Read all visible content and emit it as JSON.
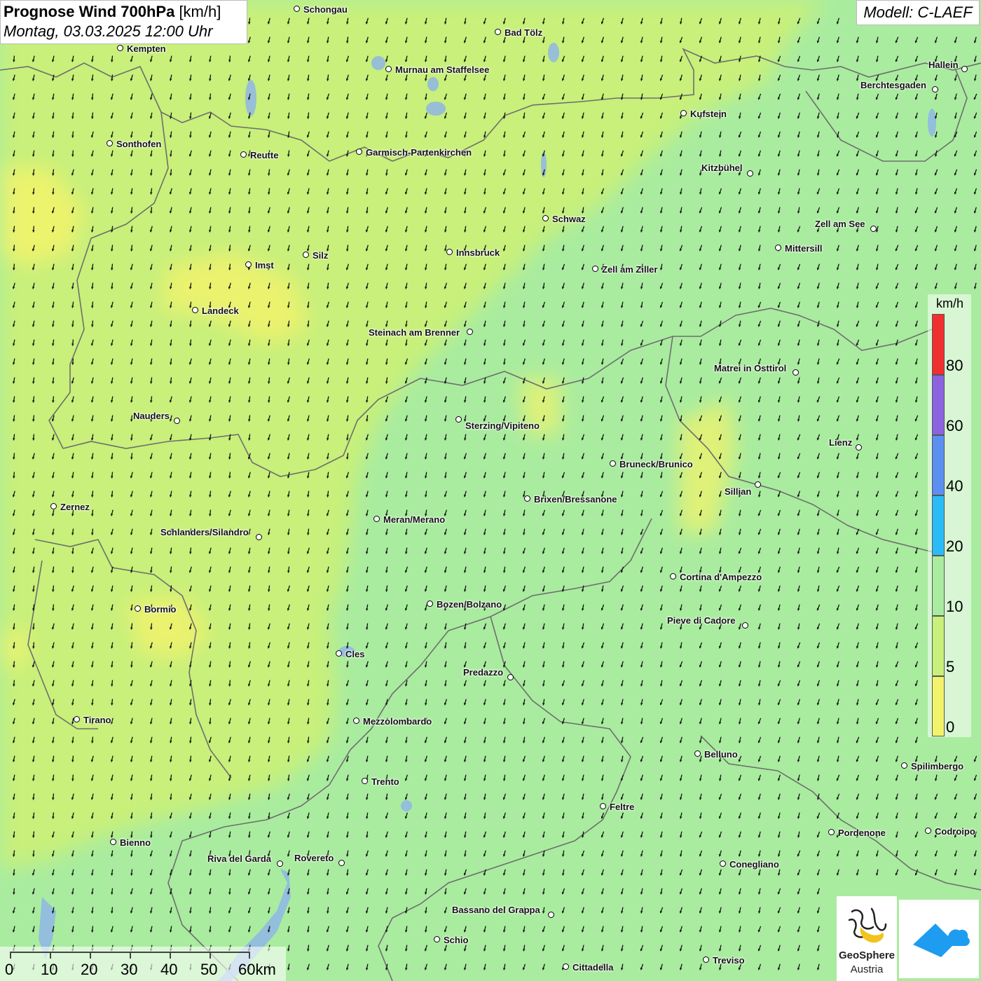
{
  "header": {
    "title_bold": "Prognose Wind 700hPa",
    "title_unit": "[km/h]",
    "datetime": "Montag, 03.03.2025 12:00 Uhr",
    "model": "Modell: C-LAEF"
  },
  "colors": {
    "speed_0_5": "#f2f36b",
    "speed_5_10": "#c8f07a",
    "speed_10_20": "#a9ec9f",
    "speed_20_40": "#2bbcf7",
    "speed_40_60": "#5b8ff2",
    "speed_60_80": "#8c62e0",
    "speed_80plus": "#f03030",
    "border_line": "#6e6e6e",
    "lake": "#8fb6e6"
  },
  "legend": {
    "unit": "km/h",
    "ticks": [
      "80",
      "60",
      "40",
      "20",
      "10",
      "5",
      "0"
    ]
  },
  "scale_bar": {
    "labels": [
      "0",
      "10",
      "20",
      "30",
      "40",
      "50",
      "60km"
    ]
  },
  "wind": {
    "dominant_direction": "from north-northeast",
    "arrow_icon": "wind-arrow-icon"
  },
  "cities": [
    {
      "name": "Schongau"
    },
    {
      "name": "Bad Tölz"
    },
    {
      "name": "Kempten"
    },
    {
      "name": "Murnau am Staffelsee"
    },
    {
      "name": "Hallein"
    },
    {
      "name": "Berchtesgaden"
    },
    {
      "name": "Kufstein"
    },
    {
      "name": "Sonthofen"
    },
    {
      "name": "Reutte"
    },
    {
      "name": "Garmisch-Partenkirchen"
    },
    {
      "name": "Kitzbühel"
    },
    {
      "name": "Schwaz"
    },
    {
      "name": "Zell am See"
    },
    {
      "name": "Mittersill"
    },
    {
      "name": "Innsbruck"
    },
    {
      "name": "Silz"
    },
    {
      "name": "Imst"
    },
    {
      "name": "Zell am Ziller"
    },
    {
      "name": "Landeck"
    },
    {
      "name": "Steinach am Brenner"
    },
    {
      "name": "Matrei in Osttirol"
    },
    {
      "name": "Nauders"
    },
    {
      "name": "Sterzing/Vipiteno"
    },
    {
      "name": "Lienz"
    },
    {
      "name": "Bruneck/Brunico"
    },
    {
      "name": "Sillian"
    },
    {
      "name": "Zernez"
    },
    {
      "name": "Brixen/Bressanone"
    },
    {
      "name": "Meran/Merano"
    },
    {
      "name": "Schlanders/Silandro"
    },
    {
      "name": "Cortina d'Ampezzo"
    },
    {
      "name": "Bozen/Bolzano"
    },
    {
      "name": "Bormio"
    },
    {
      "name": "Pieve di Cadore"
    },
    {
      "name": "Cles"
    },
    {
      "name": "Predazzo"
    },
    {
      "name": "Tirano"
    },
    {
      "name": "Mezzolombardo"
    },
    {
      "name": "Belluno"
    },
    {
      "name": "Spilimbergo"
    },
    {
      "name": "Trento"
    },
    {
      "name": "Feltre"
    },
    {
      "name": "Pordenone"
    },
    {
      "name": "Codroipo"
    },
    {
      "name": "Bienno"
    },
    {
      "name": "Riva del Garda"
    },
    {
      "name": "Rovereto"
    },
    {
      "name": "Conegliano"
    },
    {
      "name": "Bassano del Grappa"
    },
    {
      "name": "Schio"
    },
    {
      "name": "Treviso"
    },
    {
      "name": "Cittadella"
    }
  ],
  "logo": {
    "org_line1": "GeoSphere",
    "org_line2": "Austria"
  }
}
